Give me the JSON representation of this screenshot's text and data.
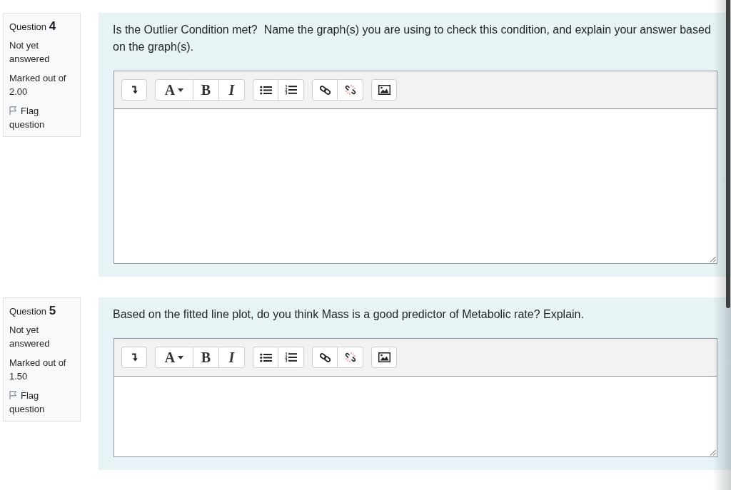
{
  "questions": [
    {
      "label": "Question",
      "number": "4",
      "status": "Not yet answered",
      "marks": "Marked out of 2.00",
      "flag_link": "Flag question",
      "prompt": "Is the Outlier Condition met?  Name the graph(s) you are using to check this condition, and explain your answer based on the graph(s).",
      "toolbar": [
        {
          "buttons": [
            {
              "kind": "expand"
            }
          ]
        },
        {
          "buttons": [
            {
              "kind": "font-color",
              "label": "A"
            },
            {
              "kind": "bold",
              "label": "B"
            },
            {
              "kind": "italic",
              "label": "I"
            }
          ]
        },
        {
          "buttons": [
            {
              "kind": "bullet-list"
            },
            {
              "kind": "numbered-list"
            }
          ]
        },
        {
          "buttons": [
            {
              "kind": "link"
            },
            {
              "kind": "unlink"
            }
          ]
        },
        {
          "buttons": [
            {
              "kind": "image"
            }
          ]
        }
      ]
    },
    {
      "label": "Question",
      "number": "5",
      "status": "Not yet answered",
      "marks": "Marked out of 1.50",
      "flag_link": "Flag question",
      "prompt": "Based on the fitted line plot, do you think Mass is a good predictor of Metabolic rate? Explain.",
      "toolbar": [
        {
          "buttons": [
            {
              "kind": "expand"
            }
          ]
        },
        {
          "buttons": [
            {
              "kind": "font-color",
              "label": "A"
            },
            {
              "kind": "bold",
              "label": "B"
            },
            {
              "kind": "italic",
              "label": "I"
            }
          ]
        },
        {
          "buttons": [
            {
              "kind": "bullet-list"
            },
            {
              "kind": "numbered-list"
            }
          ]
        },
        {
          "buttons": [
            {
              "kind": "link"
            },
            {
              "kind": "unlink"
            }
          ]
        },
        {
          "buttons": [
            {
              "kind": "image"
            }
          ]
        }
      ]
    }
  ]
}
